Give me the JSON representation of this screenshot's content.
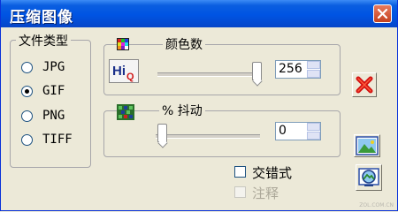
{
  "window": {
    "title": "压缩图像"
  },
  "file_type": {
    "label": "文件类型",
    "options": [
      {
        "label": "JPG",
        "selected": false
      },
      {
        "label": "GIF",
        "selected": true
      },
      {
        "label": "PNG",
        "selected": false
      },
      {
        "label": "TIFF",
        "selected": false
      }
    ]
  },
  "colors": {
    "label": "颜色数",
    "value": "256",
    "slider_level": 0.9,
    "hi_icon_text": "Hi"
  },
  "dither": {
    "label": "% 抖动",
    "value": "0",
    "slider_level": 0.0
  },
  "checkboxes": {
    "interlace": {
      "label": "交错式",
      "checked": false,
      "enabled": true
    },
    "comment": {
      "label": "注释",
      "checked": false,
      "enabled": false
    }
  },
  "buttons": {
    "cancel_icon": "red-x-icon",
    "preview_icon": "landscape-picture-icon",
    "compress_icon": "picture-magnifier-icon"
  },
  "watermark": "ZOL.COM.CN"
}
